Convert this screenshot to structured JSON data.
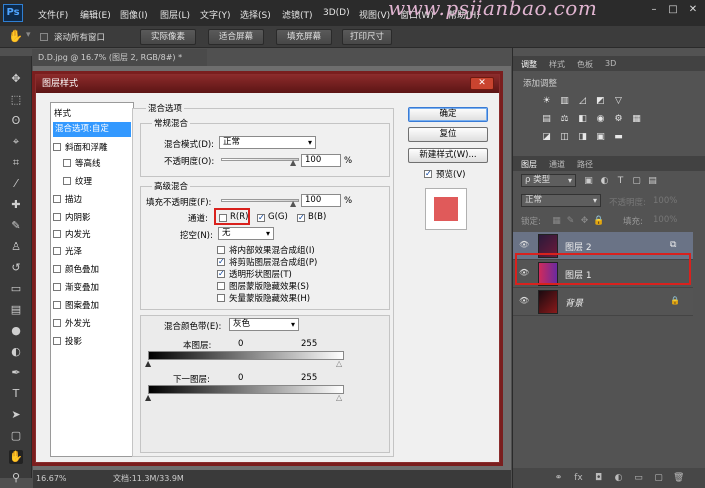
{
  "app": {
    "logo": "Ps",
    "watermark": "www.psjianbao.com"
  },
  "menu": [
    "文件(F)",
    "编辑(E)",
    "图像(I)",
    "图层(L)",
    "文字(Y)",
    "选择(S)",
    "滤镜(T)",
    "3D(D)",
    "视图(V)",
    "窗口(W)",
    "帮助(H)"
  ],
  "window_controls": [
    "–",
    "□",
    "✕"
  ],
  "options_bar": {
    "scroll_all": "滚动所有窗口",
    "buttons": [
      "实际像素",
      "适合屏幕",
      "填充屏幕",
      "打印尺寸"
    ]
  },
  "document": {
    "tab": "D.D.jpg @ 16.7% (图层 2, RGB/8#) *",
    "zoom": "16.67%",
    "status": "文档:11.3M/33.9M"
  },
  "right_panel": {
    "tabs_top": [
      "调整",
      "样式",
      "色板",
      "3D"
    ],
    "add_adjustment": "添加调整",
    "layer_tabs": [
      "图层",
      "通道",
      "路径"
    ],
    "filter_kind": "ρ 类型",
    "blend_mode": "正常",
    "opacity_label": "不透明度:",
    "opacity_value": "100%",
    "lock_label": "锁定:",
    "fill_label": "填充:",
    "fill_value": "100%",
    "layers": [
      {
        "name": "图层 2",
        "active": true
      },
      {
        "name": "图层 1",
        "active": false
      },
      {
        "name": "背景",
        "active": false
      }
    ],
    "footer": "fx"
  },
  "dialog": {
    "title": "图层样式",
    "close": "✕",
    "styles_header": "样式",
    "styles": [
      {
        "label": "混合选项:自定",
        "checked": null,
        "selected": true
      },
      {
        "label": "斜面和浮雕",
        "checked": false
      },
      {
        "label": "等高线",
        "checked": false,
        "indent": true
      },
      {
        "label": "纹理",
        "checked": false,
        "indent": true
      },
      {
        "label": "描边",
        "checked": false
      },
      {
        "label": "内阴影",
        "checked": false
      },
      {
        "label": "内发光",
        "checked": false
      },
      {
        "label": "光泽",
        "checked": false
      },
      {
        "label": "颜色叠加",
        "checked": false
      },
      {
        "label": "渐变叠加",
        "checked": false
      },
      {
        "label": "图案叠加",
        "checked": false
      },
      {
        "label": "外发光",
        "checked": false
      },
      {
        "label": "投影",
        "checked": false
      }
    ],
    "blend_options": "混合选项",
    "general_blending": "常规混合",
    "blend_mode_label": "混合模式(D):",
    "blend_mode_value": "正常",
    "opacity_label": "不透明度(O):",
    "opacity_value": "100",
    "percent": "%",
    "advanced_blending": "高级混合",
    "fill_opacity_label": "填充不透明度(F):",
    "fill_opacity_value": "100",
    "channels_label": "通道:",
    "channel_r": "R(R)",
    "channel_g": "G(G)",
    "channel_b": "B(B)",
    "knockout_label": "挖空(N):",
    "knockout_value": "无",
    "options": [
      {
        "label": "将内部效果混合成组(I)",
        "checked": false
      },
      {
        "label": "将剪贴图层混合成组(P)",
        "checked": true
      },
      {
        "label": "透明形状图层(T)",
        "checked": true
      },
      {
        "label": "图层蒙版隐藏效果(S)",
        "checked": false
      },
      {
        "label": "矢量蒙版隐藏效果(H)",
        "checked": false
      }
    ],
    "blend_if_label": "混合颜色带(E):",
    "blend_if_value": "灰色",
    "this_layer": "本图层:",
    "underlying_layer": "下一图层:",
    "range_min": "0",
    "range_max": "255",
    "buttons": {
      "ok": "确定",
      "reset": "复位",
      "new_style": "新建样式(W)...",
      "preview": "预览(V)"
    },
    "preview_color": "#e05a5a"
  }
}
